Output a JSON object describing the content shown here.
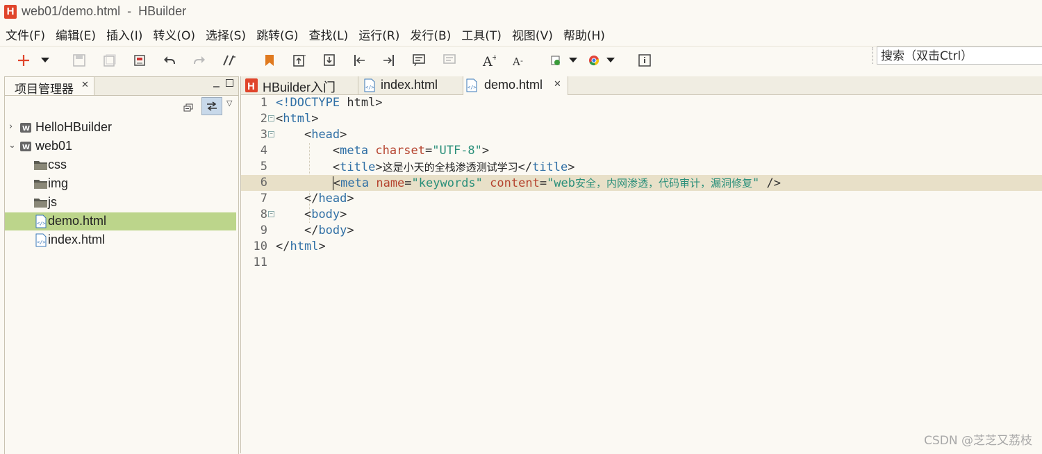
{
  "window": {
    "title": "web01/demo.html  -  HBuilder",
    "logo_letter": "H"
  },
  "menu": [
    "文件(F)",
    "编辑(E)",
    "插入(I)",
    "转义(O)",
    "选择(S)",
    "跳转(G)",
    "查找(L)",
    "运行(R)",
    "发行(B)",
    "工具(T)",
    "视图(V)",
    "帮助(H)"
  ],
  "search": {
    "placeholder": "搜索（双击Ctrl）"
  },
  "project_panel": {
    "tab_label": "项目管理器",
    "tree": [
      {
        "label": "HelloHBuilder",
        "type": "project",
        "expanded": false,
        "depth": 0
      },
      {
        "label": "web01",
        "type": "project",
        "expanded": true,
        "depth": 0
      },
      {
        "label": "css",
        "type": "folder",
        "depth": 1
      },
      {
        "label": "img",
        "type": "folder",
        "depth": 1
      },
      {
        "label": "js",
        "type": "folder",
        "depth": 1
      },
      {
        "label": "demo.html",
        "type": "html-file",
        "depth": 1,
        "selected": true
      },
      {
        "label": "index.html",
        "type": "html-file",
        "depth": 1
      }
    ]
  },
  "editor": {
    "tabs": [
      {
        "label": "HBuilder入门",
        "icon": "hbuilder-icon"
      },
      {
        "label": "index.html",
        "icon": "html-file-icon"
      },
      {
        "label": "demo.html",
        "icon": "html-file-icon",
        "active": true
      }
    ],
    "current_line": 6,
    "lines": [
      {
        "n": "1",
        "fold": false
      },
      {
        "n": "2",
        "fold": true
      },
      {
        "n": "3",
        "fold": true
      },
      {
        "n": "4",
        "fold": false
      },
      {
        "n": "5",
        "fold": false
      },
      {
        "n": "6",
        "fold": false
      },
      {
        "n": "7",
        "fold": false
      },
      {
        "n": "8",
        "fold": true
      },
      {
        "n": "9",
        "fold": false
      },
      {
        "n": "10",
        "fold": false
      },
      {
        "n": "11",
        "fold": false
      }
    ],
    "code": {
      "l1_doctype": "<!DOCTYPE",
      "l1_html": " html>",
      "l2_open": "<",
      "l2_tag": "html",
      "l2_close": ">",
      "l3_open": "<",
      "l3_tag": "head",
      "l3_close": ">",
      "l4_open": "<",
      "l4_tag": "meta",
      "l4_attr": "charset",
      "l4_eq": "=",
      "l4_val": "\"UTF-8\"",
      "l4_close": ">",
      "l5_open": "<",
      "l5_tag": "title",
      "l5_close1": ">",
      "l5_text": "这是小天的全栈渗透测试学习",
      "l5_end_open": "</",
      "l5_end_tag": "title",
      "l5_end_close": ">",
      "l6_open": "<",
      "l6_tag": "meta",
      "l6_attr1": "name",
      "l6_eq1": "=",
      "l6_val1": "\"keywords\"",
      "l6_attr2": "content",
      "l6_eq2": "=",
      "l6_val2_q1": "\"web",
      "l6_val2_text": "安全，内网渗透，代码审计，漏洞修复",
      "l6_val2_q2": "\"",
      "l6_close": " />",
      "l7_open": "</",
      "l7_tag": "head",
      "l7_close": ">",
      "l8_open": "<",
      "l8_tag": "body",
      "l8_close": ">",
      "l9_open": "</",
      "l9_tag": "body",
      "l9_close": ">",
      "l10_open": "</",
      "l10_tag": "html",
      "l10_close": ">"
    }
  },
  "watermark": "CSDN @芝芝又荔枝",
  "colors": {
    "accent_logo": "#e0452b",
    "selection": "#bcd58b",
    "current_line": "#e8e0c8",
    "tag": "#2f6fa5",
    "attr": "#b5432e",
    "string": "#2a8f7a"
  }
}
